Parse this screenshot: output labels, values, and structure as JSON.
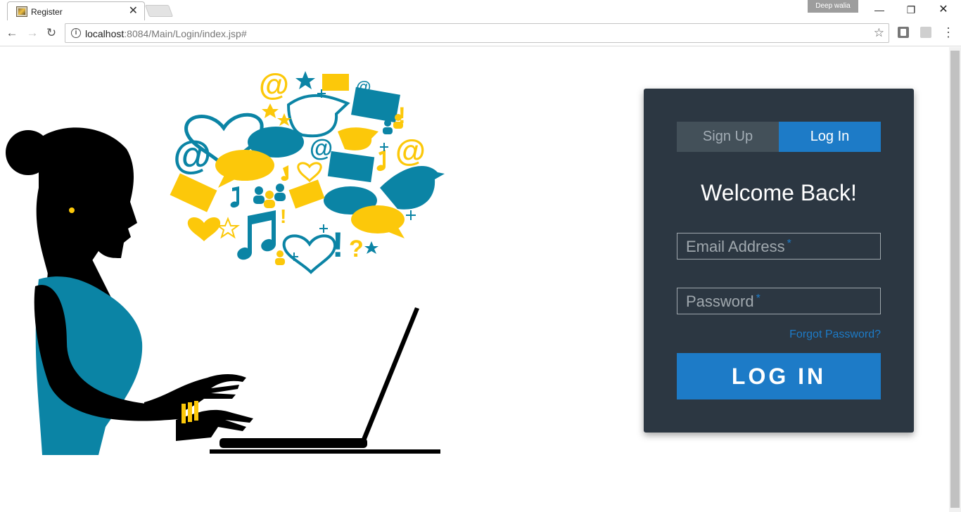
{
  "browser": {
    "tab_title": "Register",
    "profile_name": "Deep walia",
    "url_host": "localhost",
    "url_rest": ":8084/Main/Login/index.jsp#",
    "icons": {
      "back": "arrow-left-icon",
      "forward": "arrow-right-icon",
      "reload": "reload-icon",
      "info": "info-icon",
      "bookmark": "star-icon",
      "menu": "kebab-menu-icon"
    }
  },
  "login": {
    "tabs": {
      "signup": "Sign Up",
      "login": "Log In"
    },
    "heading": "Welcome Back!",
    "email_placeholder": "Email Address",
    "password_placeholder": "Password",
    "required_mark": "*",
    "forgot_link": "Forgot Password?",
    "submit_label": "LOG IN"
  },
  "colors": {
    "card_bg": "#2c3742",
    "accent_blue": "#1d7bc7",
    "inactive_tab": "#435059",
    "illustration_blue": "#0b84a5",
    "illustration_yellow": "#fcc80a"
  }
}
